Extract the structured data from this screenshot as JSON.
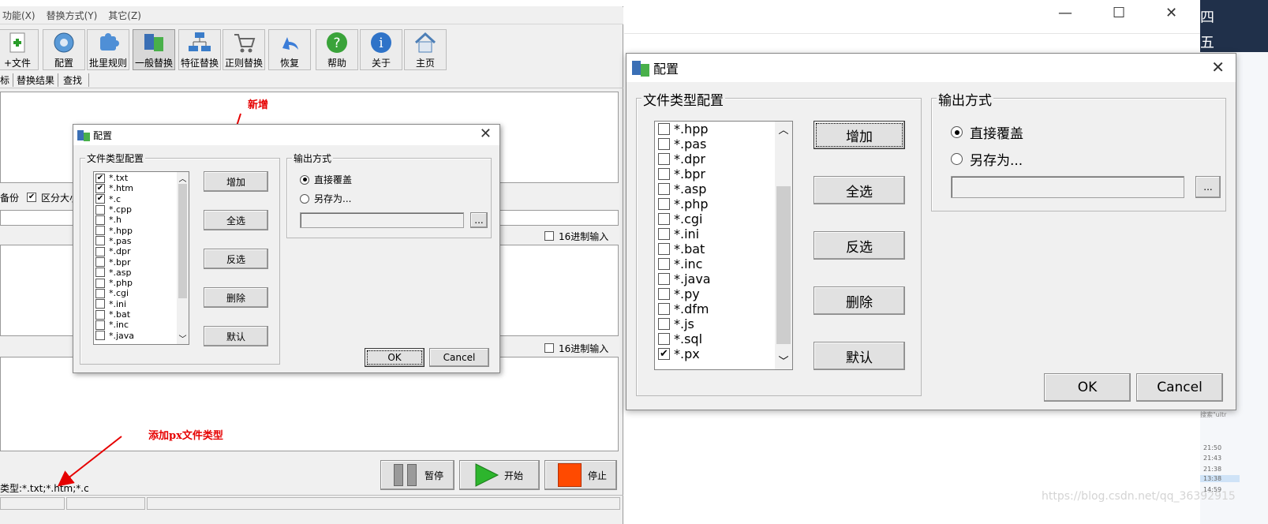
{
  "main_app": {
    "menu": [
      "功能(X)",
      "替换方式(Y)",
      "其它(Z)"
    ],
    "toolbar": [
      "+文件",
      "配置",
      "批里规则",
      "一般替换",
      "特征替换",
      "正则替换",
      "恢复",
      "帮助",
      "关于",
      "主页"
    ],
    "tabs": [
      "标",
      "替换结果",
      "查找"
    ],
    "options": {
      "backup": "备份",
      "case": "区分大小"
    },
    "hex_input": "16进制输入",
    "bottom_buttons": {
      "pause": "暂停",
      "start": "开始",
      "stop": "停止"
    },
    "status_type": "类型:*.txt;*.htm;*.c"
  },
  "annotations": {
    "new": "新增",
    "add_px": "添加px文件类型"
  },
  "config_small": {
    "title": "配置",
    "group_filetypes": "文件类型配置",
    "group_output": "输出方式",
    "items": [
      {
        "label": "*.txt",
        "checked": true
      },
      {
        "label": "*.htm",
        "checked": true
      },
      {
        "label": "*.c",
        "checked": true
      },
      {
        "label": "*.cpp",
        "checked": false
      },
      {
        "label": "*.h",
        "checked": false
      },
      {
        "label": "*.hpp",
        "checked": false
      },
      {
        "label": "*.pas",
        "checked": false
      },
      {
        "label": "*.dpr",
        "checked": false
      },
      {
        "label": "*.bpr",
        "checked": false
      },
      {
        "label": "*.asp",
        "checked": false
      },
      {
        "label": "*.php",
        "checked": false
      },
      {
        "label": "*.cgi",
        "checked": false
      },
      {
        "label": "*.ini",
        "checked": false
      },
      {
        "label": "*.bat",
        "checked": false
      },
      {
        "label": "*.inc",
        "checked": false
      },
      {
        "label": "*.java",
        "checked": false
      }
    ],
    "buttons": [
      "增加",
      "全选",
      "反选",
      "删除",
      "默认"
    ],
    "radio_overwrite": "直接覆盖",
    "radio_saveas": "另存为...",
    "browse": "...",
    "ok": "OK",
    "cancel": "Cancel"
  },
  "config_large": {
    "title": "配置",
    "group_filetypes": "文件类型配置",
    "group_output": "输出方式",
    "items": [
      {
        "label": "*.hpp",
        "checked": false
      },
      {
        "label": "*.pas",
        "checked": false
      },
      {
        "label": "*.dpr",
        "checked": false
      },
      {
        "label": "*.bpr",
        "checked": false
      },
      {
        "label": "*.asp",
        "checked": false
      },
      {
        "label": "*.php",
        "checked": false
      },
      {
        "label": "*.cgi",
        "checked": false
      },
      {
        "label": "*.ini",
        "checked": false
      },
      {
        "label": "*.bat",
        "checked": false
      },
      {
        "label": "*.inc",
        "checked": false
      },
      {
        "label": "*.java",
        "checked": false
      },
      {
        "label": "*.py",
        "checked": false
      },
      {
        "label": "*.dfm",
        "checked": false
      },
      {
        "label": "*.js",
        "checked": false
      },
      {
        "label": "*.sql",
        "checked": false
      },
      {
        "label": "*.px",
        "checked": true
      }
    ],
    "buttons": [
      "增加",
      "全选",
      "反选",
      "删除",
      "默认"
    ],
    "radio_overwrite": "直接覆盖",
    "radio_saveas": "另存为...",
    "browse": "...",
    "ok": "OK",
    "cancel": "Cancel"
  },
  "side_times": [
    "21:50",
    "21:43",
    "21:38",
    "13:38",
    "14:59"
  ],
  "side_search": "搜索\"ultr",
  "side_glyphs": [
    "四",
    "五"
  ],
  "watermark": "https://blog.csdn.net/qq_36392915"
}
